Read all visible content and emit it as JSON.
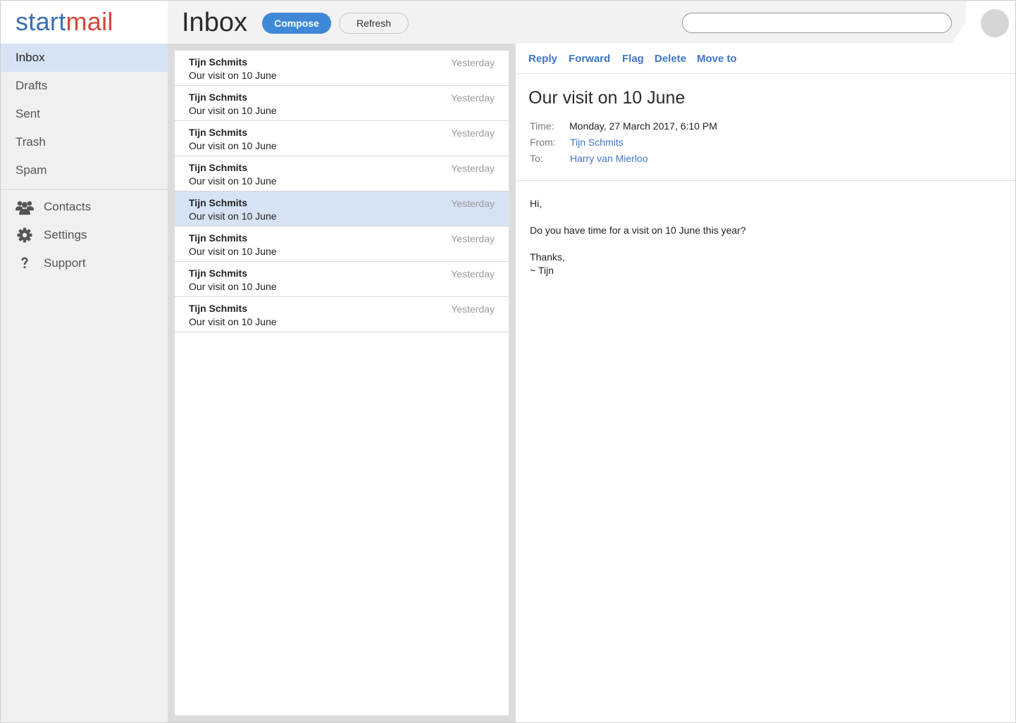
{
  "brand": {
    "part1": "start",
    "part2": "mail"
  },
  "header": {
    "title": "Inbox",
    "compose_label": "Compose",
    "refresh_label": "Refresh",
    "search_placeholder": ""
  },
  "sidebar": {
    "folders": [
      {
        "label": "Inbox",
        "active": true
      },
      {
        "label": "Drafts",
        "active": false
      },
      {
        "label": "Sent",
        "active": false
      },
      {
        "label": "Trash",
        "active": false
      },
      {
        "label": "Spam",
        "active": false
      }
    ],
    "utilities": [
      {
        "label": "Contacts",
        "icon": "contacts-icon"
      },
      {
        "label": "Settings",
        "icon": "gear-icon"
      },
      {
        "label": "Support",
        "icon": "question-icon"
      }
    ]
  },
  "messages": [
    {
      "sender": "Tijn Schmits",
      "subject": "Our visit on 10 June",
      "date": "Yesterday",
      "selected": false
    },
    {
      "sender": "Tijn Schmits",
      "subject": "Our visit on 10 June",
      "date": "Yesterday",
      "selected": false
    },
    {
      "sender": "Tijn Schmits",
      "subject": "Our visit on 10 June",
      "date": "Yesterday",
      "selected": false
    },
    {
      "sender": "Tijn Schmits",
      "subject": "Our visit on 10 June",
      "date": "Yesterday",
      "selected": false
    },
    {
      "sender": "Tijn Schmits",
      "subject": "Our visit on 10 June",
      "date": "Yesterday",
      "selected": true
    },
    {
      "sender": "Tijn Schmits",
      "subject": "Our visit on 10 June",
      "date": "Yesterday",
      "selected": false
    },
    {
      "sender": "Tijn Schmits",
      "subject": "Our visit on 10 June",
      "date": "Yesterday",
      "selected": false
    },
    {
      "sender": "Tijn Schmits",
      "subject": "Our visit on 10 June",
      "date": "Yesterday",
      "selected": false
    }
  ],
  "reader": {
    "actions": {
      "reply": "Reply",
      "forward": "Forward",
      "flag": "Flag",
      "delete": "Delete",
      "move_to": "Move to"
    },
    "subject": "Our visit on 10 June",
    "meta": {
      "time_label": "Time:",
      "time_value": "Monday, 27 March 2017, 6:10 PM",
      "from_label": "From:",
      "from_value": "Tijn Schmits",
      "to_label": "To:",
      "to_value": "Harry van Mierloo"
    },
    "body": {
      "greeting": "Hi,",
      "line1": "Do you have time for a visit on 10 June this year?",
      "closing": "Thanks,",
      "signature": "~ Tijn"
    }
  },
  "colors": {
    "accent": "#3f88d8",
    "link": "#3f75c9",
    "brand_blue": "#3a6fb5",
    "brand_red": "#d9443a",
    "selection": "#d6e3f5"
  }
}
